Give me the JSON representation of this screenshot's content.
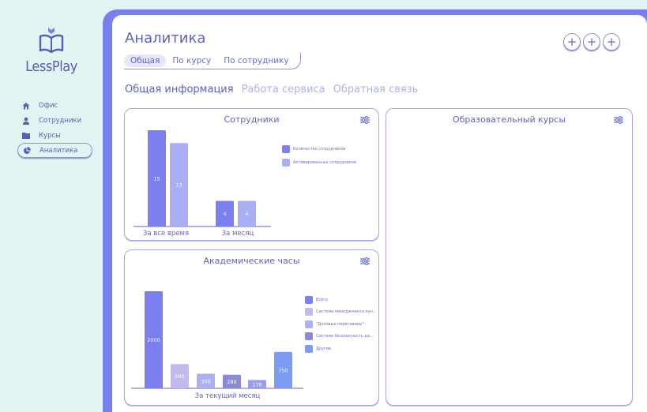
{
  "brand": {
    "name": "LessPlay"
  },
  "sidebar": {
    "items": [
      {
        "label": "Офис",
        "icon": "home-icon",
        "active": false
      },
      {
        "label": "Сотрудники",
        "icon": "person-icon",
        "active": false
      },
      {
        "label": "Курсы",
        "icon": "folder-icon",
        "active": false
      },
      {
        "label": "Аналитика",
        "icon": "pie-chart-icon",
        "active": true
      }
    ]
  },
  "header": {
    "title": "Аналитика",
    "tabs": [
      {
        "label": "Общая",
        "active": true
      },
      {
        "label": "По курсу",
        "active": false
      },
      {
        "label": "По сотруднику",
        "active": false
      }
    ],
    "plus_buttons": [
      "+",
      "+",
      "+"
    ]
  },
  "subtabs": [
    {
      "label": "Общая информация",
      "active": true
    },
    {
      "label": "Работа сервиса",
      "active": false
    },
    {
      "label": "Обратная связь",
      "active": false
    }
  ],
  "colors": {
    "accent": "#7a7ff0",
    "bar_primary": "#7b7ff0",
    "bar_secondary": "#aaaef3",
    "bar_light": "#c2b9ef",
    "bar_mid": "#a3a7ea",
    "bar_dark": "#8a8bd4",
    "bar_blue": "#7c9cf4"
  },
  "cards": {
    "employees": {
      "title": "Сотрудники"
    },
    "courses": {
      "title": "Образовательный курсы"
    },
    "hours": {
      "title": "Академические часы"
    }
  },
  "chart_data": [
    {
      "type": "bar",
      "title": "Сотрудники",
      "categories": [
        "За все время",
        "За месяц"
      ],
      "series": [
        {
          "name": "Количество сотрудников",
          "color": "#7b7ff0",
          "values": [
            15,
            4
          ]
        },
        {
          "name": "Активированных сотрудников",
          "color": "#aaaef3",
          "values": [
            13,
            4
          ]
        }
      ],
      "ylim": [
        0,
        15
      ],
      "legend": "right"
    },
    {
      "type": "bar",
      "title": "Академические часы",
      "categories": [
        "За текущий месяц"
      ],
      "series": [
        {
          "name": "Всего",
          "color": "#7b7ff0",
          "values": [
            2000
          ]
        },
        {
          "name": "Система менеджмента кач...",
          "color": "#c2b9ef",
          "values": [
            500
          ]
        },
        {
          "name": "\"Деловые переговоры\"",
          "color": "#aeb1ef",
          "values": [
            300
          ]
        },
        {
          "name": "Система безопасность да...",
          "color": "#8a8bd4",
          "values": [
            280
          ]
        },
        {
          "name": "Другие",
          "color": "#7c9cf4",
          "values": [
            750
          ]
        }
      ],
      "extra_bar": {
        "value": 170,
        "color": "#9a9ee8"
      },
      "ylim": [
        0,
        2000
      ],
      "legend": "right"
    }
  ]
}
